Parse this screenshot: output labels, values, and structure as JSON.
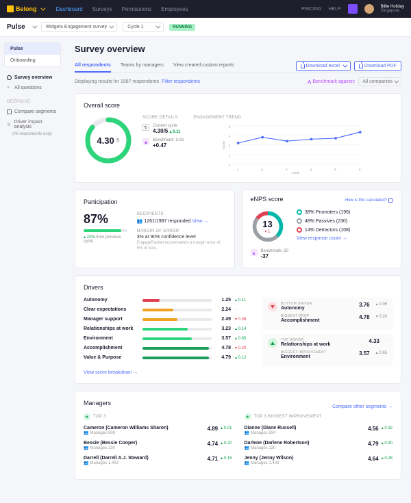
{
  "brand": "Belong",
  "nav": [
    "Dashboard",
    "Surveys",
    "Permissions",
    "Employees"
  ],
  "nav_active": 0,
  "topbar": {
    "pricing": "PRICING",
    "help": "HELP",
    "user_name": "Billie Holiday",
    "user_loc": "Singapore"
  },
  "subbar": {
    "title": "Pulse",
    "survey": "Widgets Engagement survey",
    "cycle": "Cycle 1",
    "status": "RUNNING"
  },
  "sidebar": {
    "pills": [
      "Pulse",
      "Onboarding"
    ],
    "pill_active": 0,
    "links": [
      "Survey overview",
      "All questions"
    ],
    "link_active": 0,
    "section": "DEEPDIVE",
    "deeplinks": [
      "Compare segments",
      "Driver impact analysis"
    ],
    "deep_sub": "(All respondents only)"
  },
  "page": {
    "title": "Survey overview",
    "tabs": [
      "All respondents",
      "Teams by managers",
      "View created custom reports"
    ],
    "tab_active": 0,
    "download_excel": "Download excel",
    "download_pdf": "Download PDF",
    "results_prefix": "Displaying results for 1987 respondents",
    "filter": "Filter respondents",
    "bench_label": "Benchmark against:",
    "bench_sel": "All companies"
  },
  "overall": {
    "title": "Overall score",
    "score": "4.30",
    "of": "/5",
    "score_details": "SCORE DETAILS",
    "current_label": "Current cycle:",
    "current_val": "4.30/5",
    "current_delta": "0.11",
    "bench_label": "Benchmark: 3.83",
    "bench_delta": "+0.47",
    "trend_label": "ENGAGEMENT TREND",
    "chart_data": {
      "type": "line",
      "xlabel": "Cycle",
      "ylabel": "Score",
      "ylim": [
        1,
        5
      ],
      "x": [
        1,
        2,
        3,
        4,
        5,
        6
      ],
      "y": [
        3.2,
        3.8,
        3.4,
        3.6,
        3.7,
        4.3
      ]
    }
  },
  "participation": {
    "title": "Participation",
    "pct": "87%",
    "delta": "22%",
    "delta_label": "from previous cycle",
    "recips_label": "RECIPIENTS",
    "recips_val": "1261/1987 responded",
    "view": "View",
    "moe_label": "MARGIN OF ERROR",
    "moe_val": "3% at 90% confidence level",
    "moe_note": "EngageRocket recommends a margin error of 5% or less."
  },
  "enps": {
    "title": "eNPS score",
    "calc": "How is this calculated?",
    "val": "13",
    "delta": "1",
    "promoters": "38% Promoters (196)",
    "passives": "48% Passives (230)",
    "detractors": "14% Detractors (108)",
    "view": "View response count",
    "bench_label": "Benchmark: 50",
    "bench_delta": "-37",
    "colors": {
      "promoters": "#00b8a9",
      "passives": "#9aa0a6",
      "detractors": "#e04050"
    }
  },
  "drivers": {
    "title": "Drivers",
    "breakdown": "View score breakdown",
    "list": [
      {
        "name": "Autonomy",
        "val": "1.25",
        "delta": "0.11",
        "dir": "up",
        "color": "#e04050",
        "pct": 25
      },
      {
        "name": "Clear expectations",
        "val": "2.24",
        "delta": "-",
        "dir": "none",
        "color": "#f0a020",
        "pct": 45
      },
      {
        "name": "Manager support",
        "val": "2.49",
        "delta": "0.08",
        "dir": "down",
        "color": "#f0a020",
        "pct": 50
      },
      {
        "name": "Relationships at work",
        "val": "3.23",
        "delta": "0.14",
        "dir": "up",
        "color": "#2dd47a",
        "pct": 65
      },
      {
        "name": "Environment",
        "val": "3.57",
        "delta": "0.65",
        "dir": "up",
        "color": "#2dd47a",
        "pct": 71
      },
      {
        "name": "Accomplishment",
        "val": "4.78",
        "delta": "0.20",
        "dir": "down",
        "color": "#1a9e5a",
        "pct": 96
      },
      {
        "name": "Value & Purpose",
        "val": "4.79",
        "delta": "0.12",
        "dir": "up",
        "color": "#1a9e5a",
        "pct": 96
      }
    ],
    "summary": [
      {
        "label": "BOTTOM DRIVER",
        "name": "Autonomy",
        "val": "3.76",
        "delta": "0.05",
        "dir": "up",
        "tone": "red"
      },
      {
        "label": "BIGGEST DROP",
        "name": "Accomplishment",
        "val": "4.78",
        "delta": "0.20",
        "dir": "down",
        "tone": "red"
      },
      {
        "label": "TOP DRIVER",
        "name": "Relationships at work",
        "val": "4.33",
        "delta": "-",
        "dir": "none",
        "tone": "grn"
      },
      {
        "label": "BIGGEST IMPROVEMENT",
        "name": "Environment",
        "val": "3.57",
        "delta": "0.65",
        "dir": "up",
        "tone": "grn"
      }
    ]
  },
  "managers": {
    "title": "Managers",
    "compare": "Compare other segments",
    "top3_label": "TOP 3",
    "top3_imp_label": "TOP 3 BIGGEST IMPROVEMENT",
    "top3": [
      {
        "name": "Cameron (Cameron Williams Sharon)",
        "manages": "Manages 636",
        "val": "4.89",
        "delta": "0.01",
        "dir": "up"
      },
      {
        "name": "Bessie (Bessie Cooper)",
        "manages": "Manages 130",
        "val": "4.74",
        "delta": "0.20",
        "dir": "up"
      },
      {
        "name": "Darrell (Darrell A.J. Steward)",
        "manages": "Manages 1,403",
        "val": "4.71",
        "delta": "0.15",
        "dir": "up"
      }
    ],
    "top3_imp": [
      {
        "name": "Dianne (Diane Russell)",
        "manages": "Manages 634",
        "val": "4.56",
        "delta": "0.32",
        "dir": "up"
      },
      {
        "name": "Darlene (Darlene Robertson)",
        "manages": "Manages 130",
        "val": "4.79",
        "delta": "0.30",
        "dir": "up"
      },
      {
        "name": "Jenny (Jenny Wilson)",
        "manages": "Manages 1,403",
        "val": "4.64",
        "delta": "0.28",
        "dir": "up"
      }
    ]
  }
}
